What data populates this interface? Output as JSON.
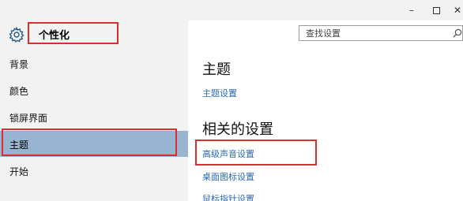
{
  "window": {
    "controls": {
      "minimize": "–",
      "close": "✕"
    }
  },
  "sidebar": {
    "icon": "gear-icon",
    "title": "个性化",
    "items": [
      {
        "label": "背景",
        "selected": false
      },
      {
        "label": "颜色",
        "selected": false
      },
      {
        "label": "锁屏界面",
        "selected": false
      },
      {
        "label": "主题",
        "selected": true
      },
      {
        "label": "开始",
        "selected": false
      }
    ]
  },
  "search": {
    "placeholder": "查找设置",
    "icon": "search-icon"
  },
  "main": {
    "section1_title": "主题",
    "section1_links": [
      "主题设置"
    ],
    "section2_title": "相关的设置",
    "section2_links": [
      "高级声音设置",
      "桌面图标设置",
      "鼠标指针设置"
    ]
  },
  "colors": {
    "selected_bg": "#99b4d1",
    "link": "#2a6ab3",
    "highlight_box": "#d9302f",
    "sidebar_bg": "#f2f2f2"
  }
}
